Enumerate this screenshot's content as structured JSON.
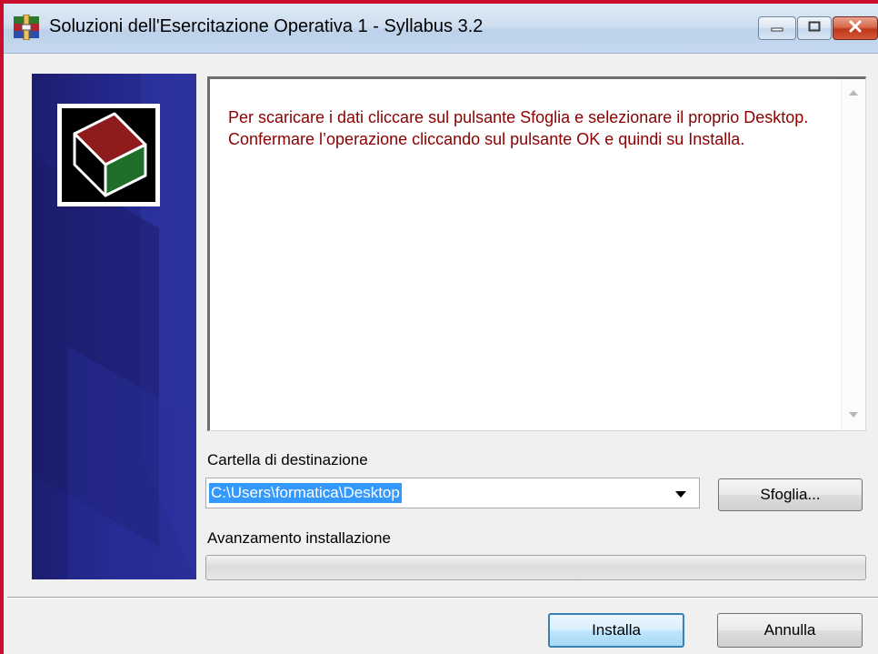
{
  "window": {
    "title": "Soluzioni dell'Esercitazione Operativa 1 - Syllabus 3.2",
    "icon": "winrar-archive-icon",
    "controls": [
      "minimize-icon",
      "maximize-icon",
      "close-icon"
    ]
  },
  "sidebar": {
    "logo": "box-package-icon"
  },
  "content": {
    "text": "Per scaricare i dati cliccare sul pulsante Sfoglia e selezionare il proprio Desktop. Confermare l’operazione cliccando sul pulsante OK e quindi su Installa."
  },
  "destination": {
    "label": "Cartella di destinazione",
    "value": "C:\\Users\\formatica\\Desktop",
    "browse_label": "Sfoglia..."
  },
  "progress": {
    "label": "Avanzamento installazione",
    "value": 0
  },
  "footer": {
    "install_label": "Installa",
    "cancel_label": "Annulla"
  },
  "colors": {
    "accent_border": "#c8102e",
    "sidebar": "#24278a",
    "content_text": "#8b0000",
    "selection": "#3399ff"
  }
}
